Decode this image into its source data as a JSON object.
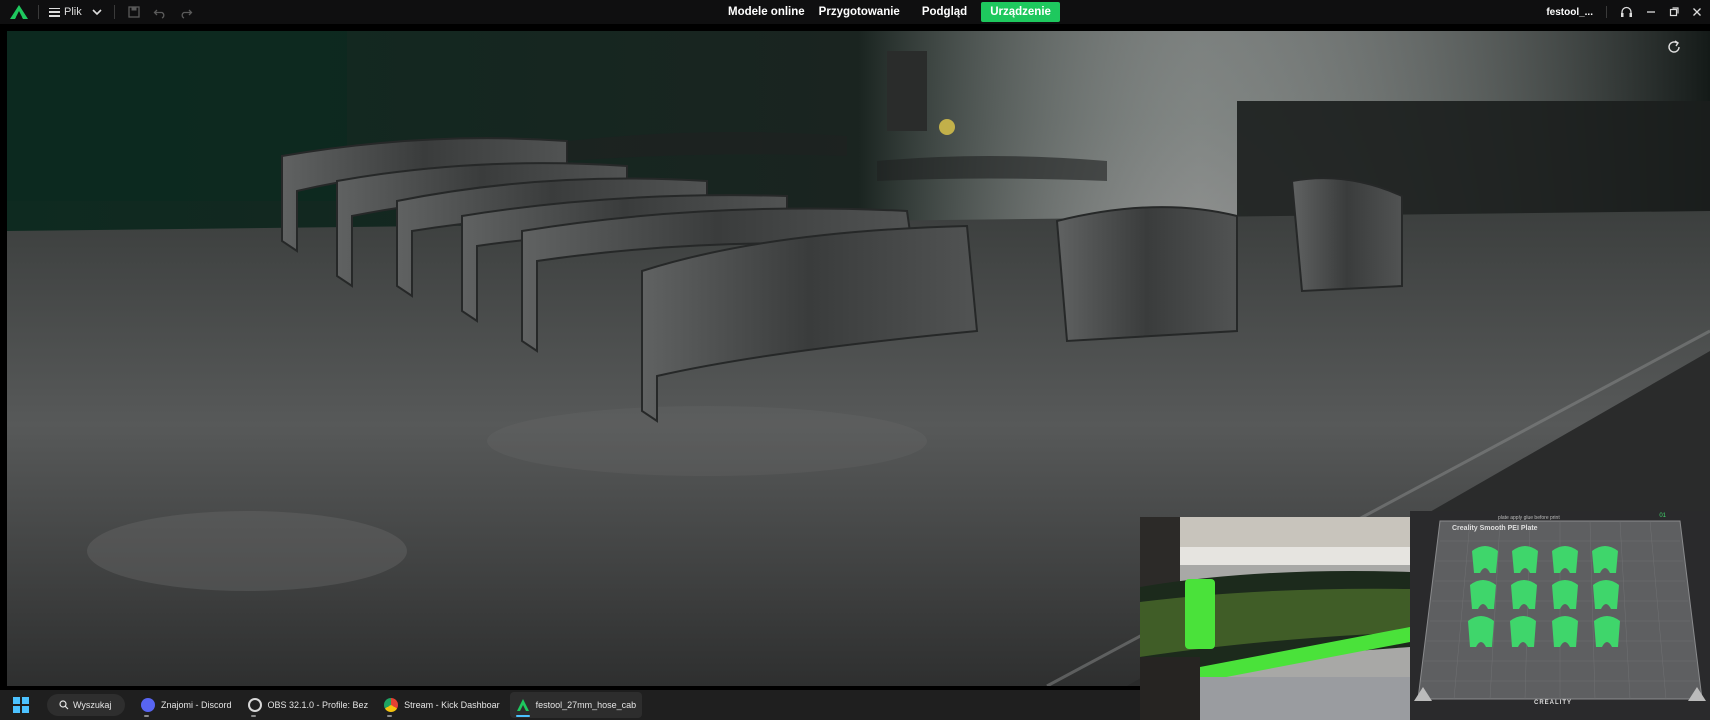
{
  "app": {
    "menu_label": "Plik",
    "tabs": [
      {
        "label": "Modele online"
      },
      {
        "label": "Przygotowanie"
      },
      {
        "label": "Podgląd"
      },
      {
        "label": "Urządzenie",
        "active": true
      }
    ],
    "project_name": "festool_..."
  },
  "colors": {
    "accent": "#1ec85e",
    "brand_green": "#3fd66b",
    "taskbar_accent": "#4cc2ff"
  },
  "plate_preview": {
    "label": "Creality Smooth PEI Plate",
    "top_text": "plate apply glue before print",
    "count": "01",
    "brand": "CREALITY"
  },
  "taskbar": {
    "search_label": "Wyszukaj",
    "items": [
      {
        "label": "Znajomi - Discord",
        "icon": "discord-icon",
        "color": "#5865f2"
      },
      {
        "label": "OBS 32.1.0 - Profile: Bez",
        "icon": "obs-icon",
        "color": "#d8d8d8"
      },
      {
        "label": "Stream - Kick Dashboar",
        "icon": "chrome-icon",
        "color": "#e34133"
      },
      {
        "label": "festool_27mm_hose_cab",
        "icon": "creality-print-icon",
        "color": "#1ec85e"
      }
    ]
  }
}
